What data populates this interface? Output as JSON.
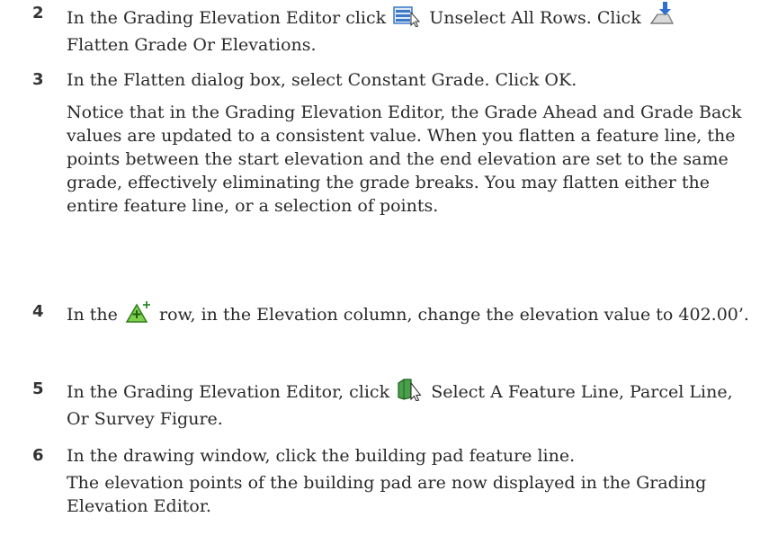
{
  "steps": [
    {
      "number": "2",
      "a": "In the Grading Elevation Editor click",
      "icon1": "unselect-all-rows-icon",
      "b": "Unselect All Rows. Click",
      "icon2": "flatten-grade-icon",
      "c": "Flatten Grade Or Elevations."
    },
    {
      "number": "3",
      "text": "In the Flatten dialog box, select Constant Grade. Click OK.",
      "note": "Notice that in the Grading Elevation Editor, the Grade Ahead and Grade Back values are updated to a consistent value. When you flatten a feature line, the points between the start elevation and the end elevation are set to the same grade, effectively eliminating the grade breaks. You may flatten either the entire feature line, or a selection of points."
    },
    {
      "number": "4",
      "a": "In the",
      "icon1": "insert-elevation-point-icon",
      "b": "row, in the Elevation column, change the elevation value to 402.00’."
    },
    {
      "number": "5",
      "a": "In the Grading Elevation Editor, click",
      "icon1": "select-feature-line-icon",
      "b": "Select A Feature Line, Parcel Line, Or Survey Figure."
    },
    {
      "number": "6",
      "text": "In the drawing window, click the building pad feature line.",
      "note": "The elevation points of the building pad are now displayed in the Grading Elevation Editor."
    }
  ],
  "colors": {
    "text": "#2a2a2a",
    "icon_blue": "#3a78c8",
    "icon_green": "#2e8b2e"
  }
}
